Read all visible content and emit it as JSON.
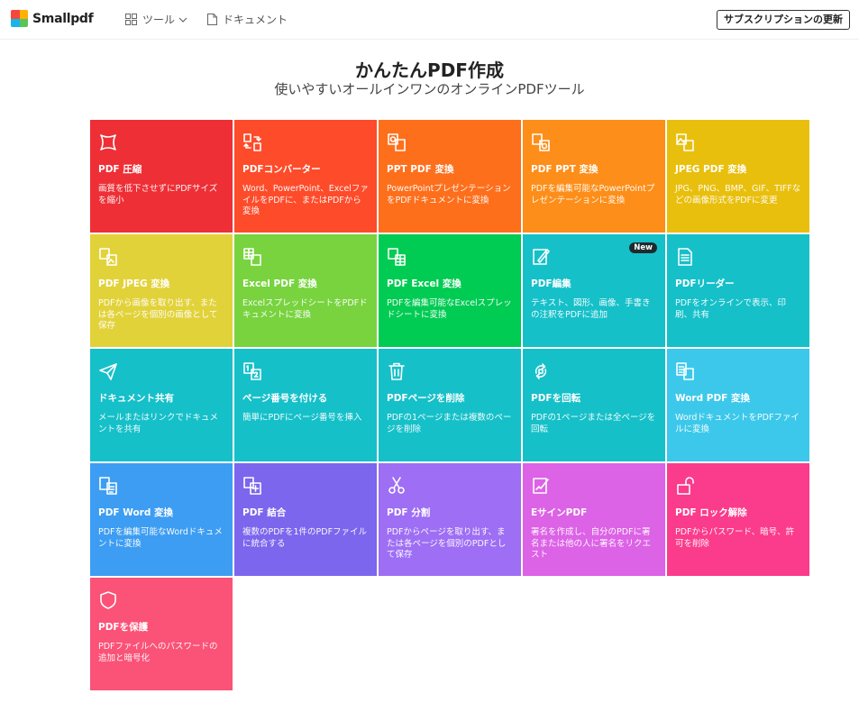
{
  "header": {
    "brand": "Smallpdf",
    "nav_tools": "ツール",
    "nav_documents": "ドキュメント",
    "subscribe_label": "サブスクリプションの更新"
  },
  "hero": {
    "title": "かんたんPDF作成",
    "subtitle": "使いやすいオールインワンのオンラインPDFツール"
  },
  "colors": {
    "logo": [
      "#f5483a",
      "#ffb000",
      "#1ab5e8",
      "#5ac35a"
    ]
  },
  "tools": [
    {
      "title": "PDF 圧縮",
      "desc": "画質を低下させずにPDFサイズを縮小",
      "color": "#ee2f36",
      "icon": "compress-icon",
      "badge": ""
    },
    {
      "title": "PDFコンバーター",
      "desc": "Word、PowerPoint、ExcelファイルをPDFに、またはPDFから変換",
      "color": "#fe4b2a",
      "icon": "converter-icon",
      "badge": ""
    },
    {
      "title": "PPT PDF 変換",
      "desc": "PowerPointプレゼンテーションをPDFドキュメントに変換",
      "color": "#fe6f1c",
      "icon": "ppt-to-pdf-icon",
      "badge": ""
    },
    {
      "title": "PDF PPT 変換",
      "desc": "PDFを編集可能なPowerPointプレゼンテーションに変換",
      "color": "#fd8e19",
      "icon": "pdf-to-ppt-icon",
      "badge": ""
    },
    {
      "title": "JPEG PDF 変換",
      "desc": "JPG、PNG、BMP、GIF、TIFFなどの画像形式をPDFに変更",
      "color": "#e9bf0d",
      "icon": "jpg-to-pdf-icon",
      "badge": ""
    },
    {
      "title": "PDF JPEG 変換",
      "desc": "PDFから画像を取り出す、または各ページを個別の画像として保存",
      "color": "#e2d23a",
      "icon": "pdf-to-jpg-icon",
      "badge": ""
    },
    {
      "title": "Excel PDF 変換",
      "desc": "ExcelスプレッドシートをPDFドキュメントに変換",
      "color": "#78d33f",
      "icon": "excel-to-pdf-icon",
      "badge": ""
    },
    {
      "title": "PDF Excel 変換",
      "desc": "PDFを編集可能なExcelスプレッドシートに変換",
      "color": "#00cb53",
      "icon": "pdf-to-excel-icon",
      "badge": ""
    },
    {
      "title": "PDF編集",
      "desc": "テキスト、図形、画像、手書きの注釈をPDFに追加",
      "color": "#15c0c9",
      "icon": "edit-pdf-icon",
      "badge": "New"
    },
    {
      "title": "PDFリーダー",
      "desc": "PDFをオンラインで表示、印刷、共有",
      "color": "#15c0c9",
      "icon": "reader-icon",
      "badge": ""
    },
    {
      "title": "ドキュメント共有",
      "desc": "メールまたはリンクでドキュメントを共有",
      "color": "#15c0c9",
      "icon": "share-icon",
      "badge": ""
    },
    {
      "title": "ページ番号を付ける",
      "desc": "簡単にPDFにページ番号を挿入",
      "color": "#15c0c9",
      "icon": "page-numbers-icon",
      "badge": ""
    },
    {
      "title": "PDFページを削除",
      "desc": "PDFの1ページまたは複数のページを削除",
      "color": "#15c0c9",
      "icon": "trash-icon",
      "badge": ""
    },
    {
      "title": "PDFを回転",
      "desc": "PDFの1ページまたは全ページを回転",
      "color": "#15c0c9",
      "icon": "rotate-icon",
      "badge": ""
    },
    {
      "title": "Word PDF 変換",
      "desc": "WordドキュメントをPDFファイルに変換",
      "color": "#3cc8ea",
      "icon": "word-to-pdf-icon",
      "badge": ""
    },
    {
      "title": "PDF Word 変換",
      "desc": "PDFを編集可能なWordドキュメントに変換",
      "color": "#3d9df2",
      "icon": "pdf-to-word-icon",
      "badge": ""
    },
    {
      "title": "PDF 結合",
      "desc": "複数のPDFを1件のPDFファイルに統合する",
      "color": "#7b66ed",
      "icon": "merge-icon",
      "badge": ""
    },
    {
      "title": "PDF 分割",
      "desc": "PDFからページを取り出す、または各ページを個別のPDFとして保存",
      "color": "#9e6ef4",
      "icon": "scissors-icon",
      "badge": ""
    },
    {
      "title": "EサインPDF",
      "desc": "署名を作成し、自分のPDFに署名または他の人に署名をリクエスト",
      "color": "#dc62e6",
      "icon": "esign-icon",
      "badge": ""
    },
    {
      "title": "PDF ロック解除",
      "desc": "PDFからパスワード、暗号、許可を削除",
      "color": "#fb3b8b",
      "icon": "unlock-icon",
      "badge": ""
    },
    {
      "title": "PDFを保護",
      "desc": "PDFファイルへのパスワードの追加と暗号化",
      "color": "#fb5277",
      "icon": "shield-icon",
      "badge": ""
    }
  ]
}
